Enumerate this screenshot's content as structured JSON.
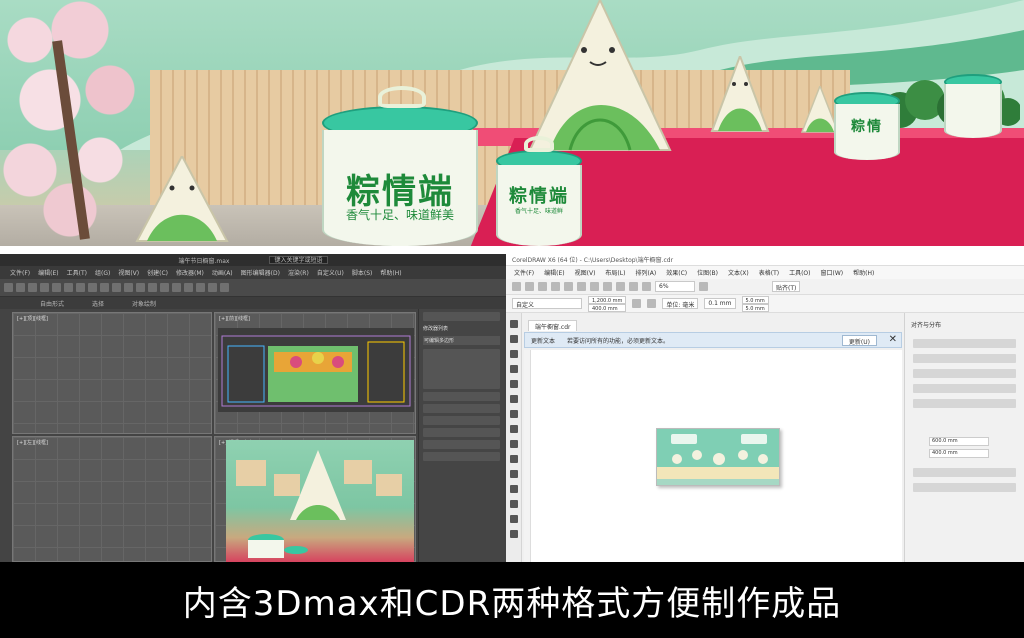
{
  "render": {
    "drum_large_title": "粽情端",
    "drum_large_sub": "香气十足、味道鲜美",
    "drum_mid_title": "粽情端",
    "drum_mid_sub": "香气十足、味道鲜",
    "drum_small_title": "粽情",
    "colors": {
      "stage": "#d91f54",
      "wall": "#8ecfb2",
      "drum_lid": "#38c7a1",
      "drum_text": "#1e8a3a"
    }
  },
  "max_window": {
    "title": "端午节日橱窗.max",
    "search_placeholder": "键入关键字或短语",
    "menu": [
      "文件(F)",
      "编辑(E)",
      "工具(T)",
      "组(G)",
      "视图(V)",
      "创建(C)",
      "修改器(M)",
      "动画(A)",
      "图形编辑器(D)",
      "渲染(R)",
      "自定义(U)",
      "脚本(S)",
      "帮助(H)"
    ],
    "tabs": [
      "自由形式",
      "选择",
      "对象绘制"
    ],
    "viewport_labels": [
      "[+][顶][线框]",
      "[+][前][线框]",
      "[+][左][线框]",
      "[+][透视][真实]"
    ],
    "cmd_labels": [
      "修改器列表",
      "可编辑多边形"
    ]
  },
  "cdr_window": {
    "title": "CorelDRAW X6 (64 位) - C:\\Users\\Desktop\\端午橱窗.cdr",
    "menu": [
      "文件(F)",
      "编辑(E)",
      "视图(V)",
      "布局(L)",
      "排列(A)",
      "效果(C)",
      "位图(B)",
      "文本(X)",
      "表格(T)",
      "工具(O)",
      "窗口(W)",
      "帮助(H)"
    ],
    "zoom": "6%",
    "page_size": "自定义",
    "width_value": "1,200.0 mm",
    "height_value": "400.0 mm",
    "unit_label": "单位: 毫米",
    "nudge": "0.1 mm",
    "dup_x": "5.0 mm",
    "dup_y": "5.0 mm",
    "snap_label": "贴齐(T)",
    "doc_tab": "端午橱窗.cdr",
    "info_title": "更新文本",
    "info_text": "若要访问所有的功能，必须更新文本。",
    "info_button": "更新(U)",
    "docker_title": "对齐与分布",
    "docker_fields": [
      "600.0 mm",
      "400.0 mm"
    ]
  },
  "caption": {
    "text": "内含3Dmax和CDR两种格式方便制作成品"
  }
}
